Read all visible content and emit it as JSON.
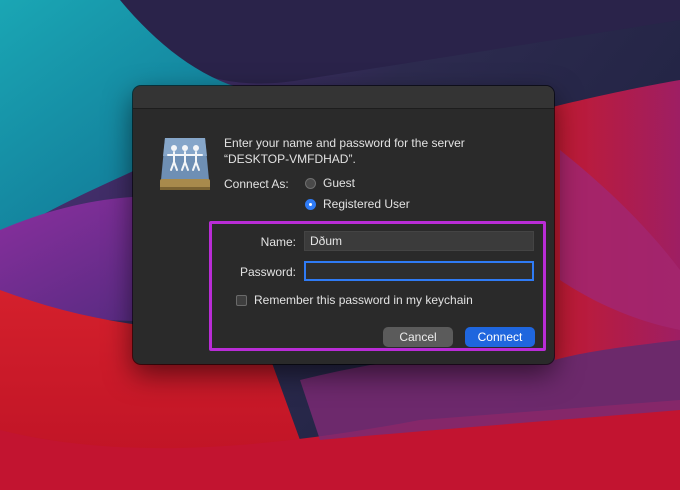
{
  "dialog": {
    "message_line1": "Enter your name and password for the server",
    "message_line2": "“DESKTOP-VMFDHAD”.",
    "connect_as_label": "Connect As:",
    "options": [
      {
        "label": "Guest",
        "selected": false
      },
      {
        "label": "Registered User",
        "selected": true
      }
    ],
    "name_label": "Name:",
    "name_value": "Dðum",
    "password_label": "Password:",
    "password_value": "",
    "remember_label": "Remember this password in my keychain",
    "remember_checked": false,
    "cancel_label": "Cancel",
    "connect_label": "Connect"
  },
  "icons": {
    "server": "shared-server-icon"
  },
  "colors": {
    "accent": "#2f7bf5",
    "highlight": "#b92cd6",
    "dialog_bg": "#2a2a2a"
  }
}
